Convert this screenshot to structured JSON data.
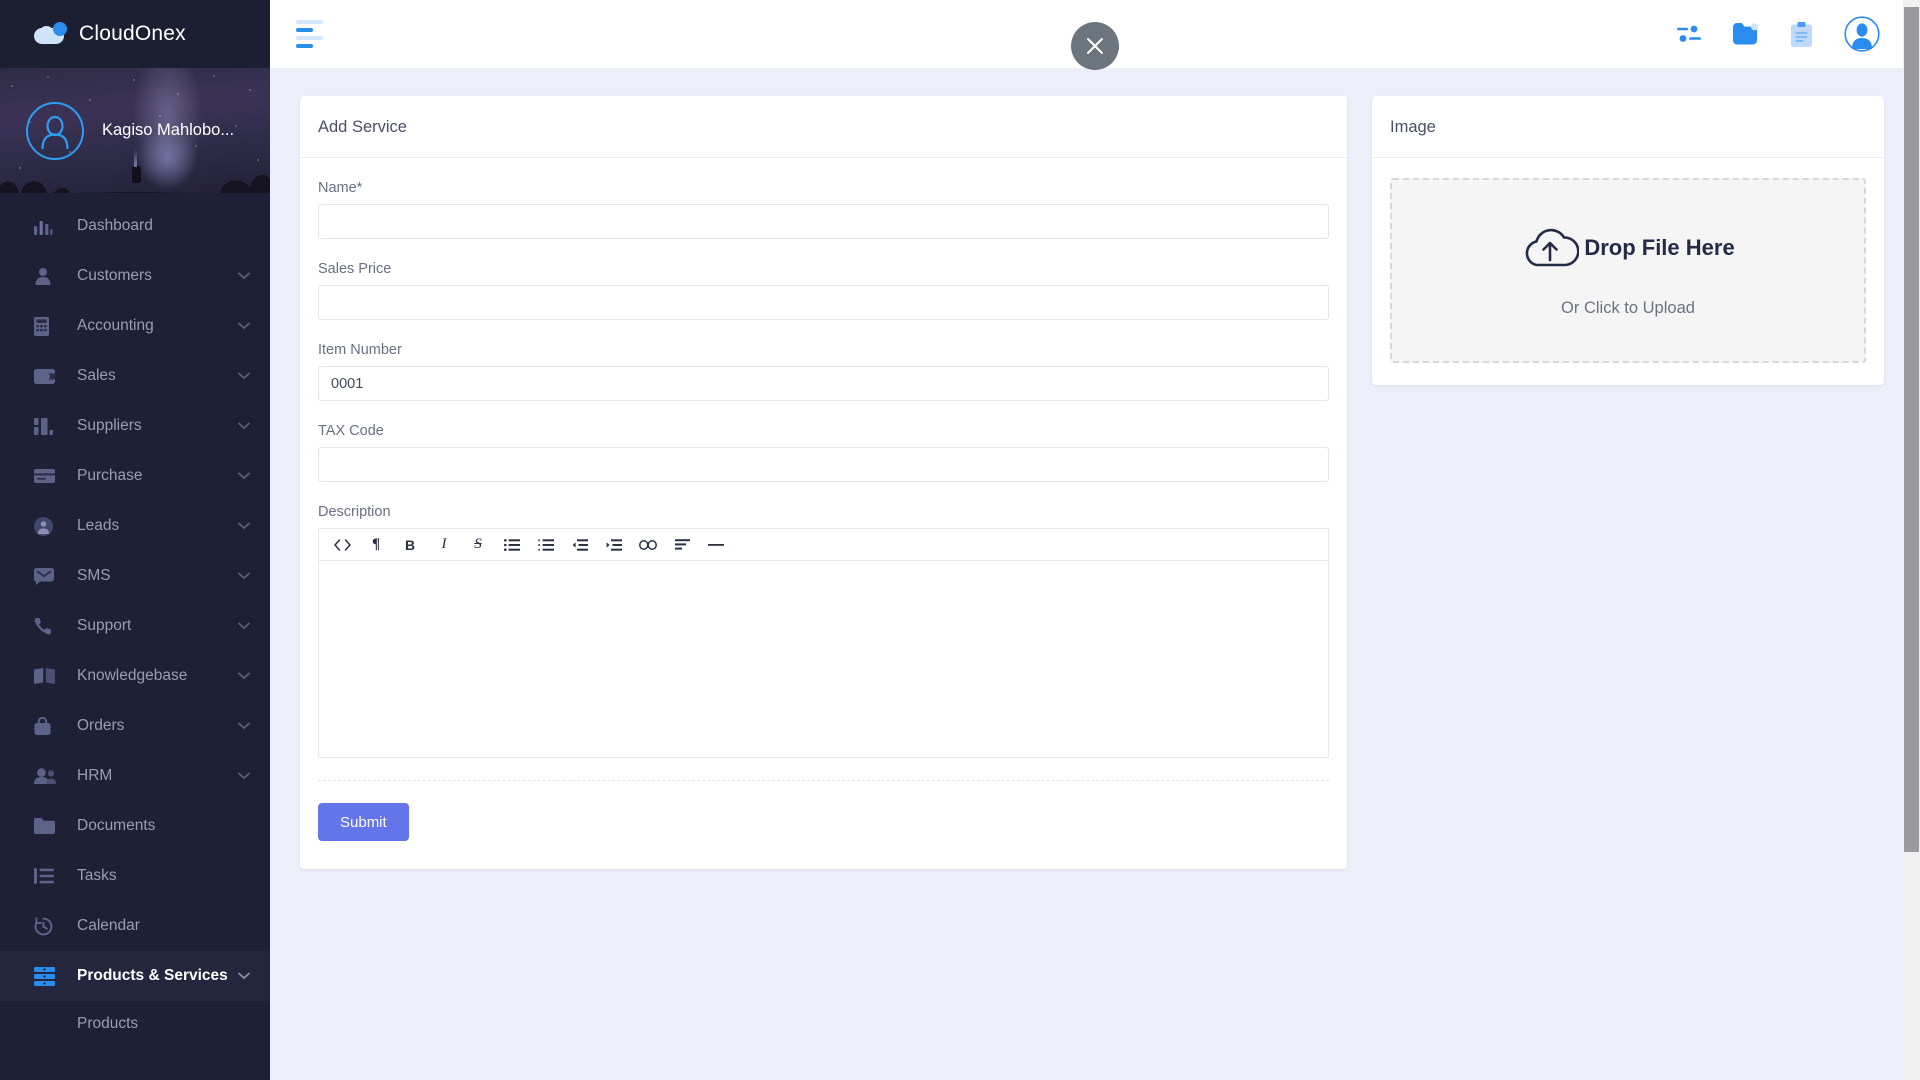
{
  "brand": {
    "name": "CloudOnex",
    "logo_icon": "cloud-icon"
  },
  "profile": {
    "name": "Kagiso Mahlobo...",
    "avatar_icon": "user-avatar-icon"
  },
  "sidebar": {
    "items": [
      {
        "label": "Dashboard",
        "icon": "bar-chart-icon",
        "expandable": false,
        "active": false
      },
      {
        "label": "Customers",
        "icon": "user-icon",
        "expandable": true,
        "active": false
      },
      {
        "label": "Accounting",
        "icon": "calculator-icon",
        "expandable": true,
        "active": false
      },
      {
        "label": "Sales",
        "icon": "wallet-icon",
        "expandable": true,
        "active": false
      },
      {
        "label": "Suppliers",
        "icon": "buildings-icon",
        "expandable": true,
        "active": false
      },
      {
        "label": "Purchase",
        "icon": "card-icon",
        "expandable": true,
        "active": false
      },
      {
        "label": "Leads",
        "icon": "user-circle-icon",
        "expandable": true,
        "active": false
      },
      {
        "label": "SMS",
        "icon": "envelope-icon",
        "expandable": true,
        "active": false
      },
      {
        "label": "Support",
        "icon": "phone-icon",
        "expandable": true,
        "active": false
      },
      {
        "label": "Knowledgebase",
        "icon": "book-icon",
        "expandable": true,
        "active": false
      },
      {
        "label": "Orders",
        "icon": "bag-icon",
        "expandable": true,
        "active": false
      },
      {
        "label": "HRM",
        "icon": "users-icon",
        "expandable": true,
        "active": false
      },
      {
        "label": "Documents",
        "icon": "folder-icon",
        "expandable": false,
        "active": false
      },
      {
        "label": "Tasks",
        "icon": "list-icon",
        "expandable": false,
        "active": false
      },
      {
        "label": "Calendar",
        "icon": "clock-icon",
        "expandable": false,
        "active": false
      },
      {
        "label": "Products & Services",
        "icon": "server-icon",
        "expandable": true,
        "active": true
      }
    ],
    "sub_items": [
      {
        "label": "Products"
      }
    ]
  },
  "topbar": {
    "menu_toggle_icon": "hamburger-icon",
    "icons": [
      {
        "name": "settings-sliders-icon"
      },
      {
        "name": "folder-notification-icon"
      },
      {
        "name": "clipboard-icon"
      },
      {
        "name": "user-avatar-icon"
      }
    ]
  },
  "close_button": {
    "icon": "close-icon",
    "label": "✕"
  },
  "form": {
    "title": "Add Service",
    "fields": [
      {
        "label": "Name*",
        "value": "",
        "placeholder": "",
        "name": "name"
      },
      {
        "label": "Sales Price",
        "value": "",
        "placeholder": "",
        "name": "sales-price"
      },
      {
        "label": "Item Number",
        "value": "0001",
        "placeholder": "",
        "name": "item-number"
      },
      {
        "label": "TAX Code",
        "value": "",
        "placeholder": "",
        "name": "tax-code"
      }
    ],
    "description_label": "Description",
    "description_value": "",
    "toolbar": [
      {
        "name": "code-icon",
        "glyph": "<>"
      },
      {
        "name": "paragraph-icon",
        "glyph": "¶"
      },
      {
        "name": "bold-icon",
        "glyph": "B"
      },
      {
        "name": "italic-icon",
        "glyph": "I"
      },
      {
        "name": "strikethrough-icon",
        "glyph": "S"
      },
      {
        "name": "unordered-list-icon",
        "glyph": ""
      },
      {
        "name": "ordered-list-icon",
        "glyph": ""
      },
      {
        "name": "outdent-icon",
        "glyph": ""
      },
      {
        "name": "indent-icon",
        "glyph": ""
      },
      {
        "name": "link-icon",
        "glyph": ""
      },
      {
        "name": "align-left-icon",
        "glyph": ""
      },
      {
        "name": "horizontal-rule-icon",
        "glyph": ""
      }
    ],
    "submit_label": "Submit"
  },
  "image_panel": {
    "title": "Image",
    "drop_title": "Drop File Here",
    "drop_subtitle": "Or Click to Upload",
    "upload_icon": "cloud-upload-icon"
  },
  "colors": {
    "sidebar_bg": "#1e2035",
    "brand_bg": "#1c1e31",
    "accent_blue": "#2b8cf0",
    "submit_blue": "#6375e9",
    "page_bg": "#eceefa",
    "close_gray": "#6c757d",
    "dropzone_text": "#252a46"
  }
}
